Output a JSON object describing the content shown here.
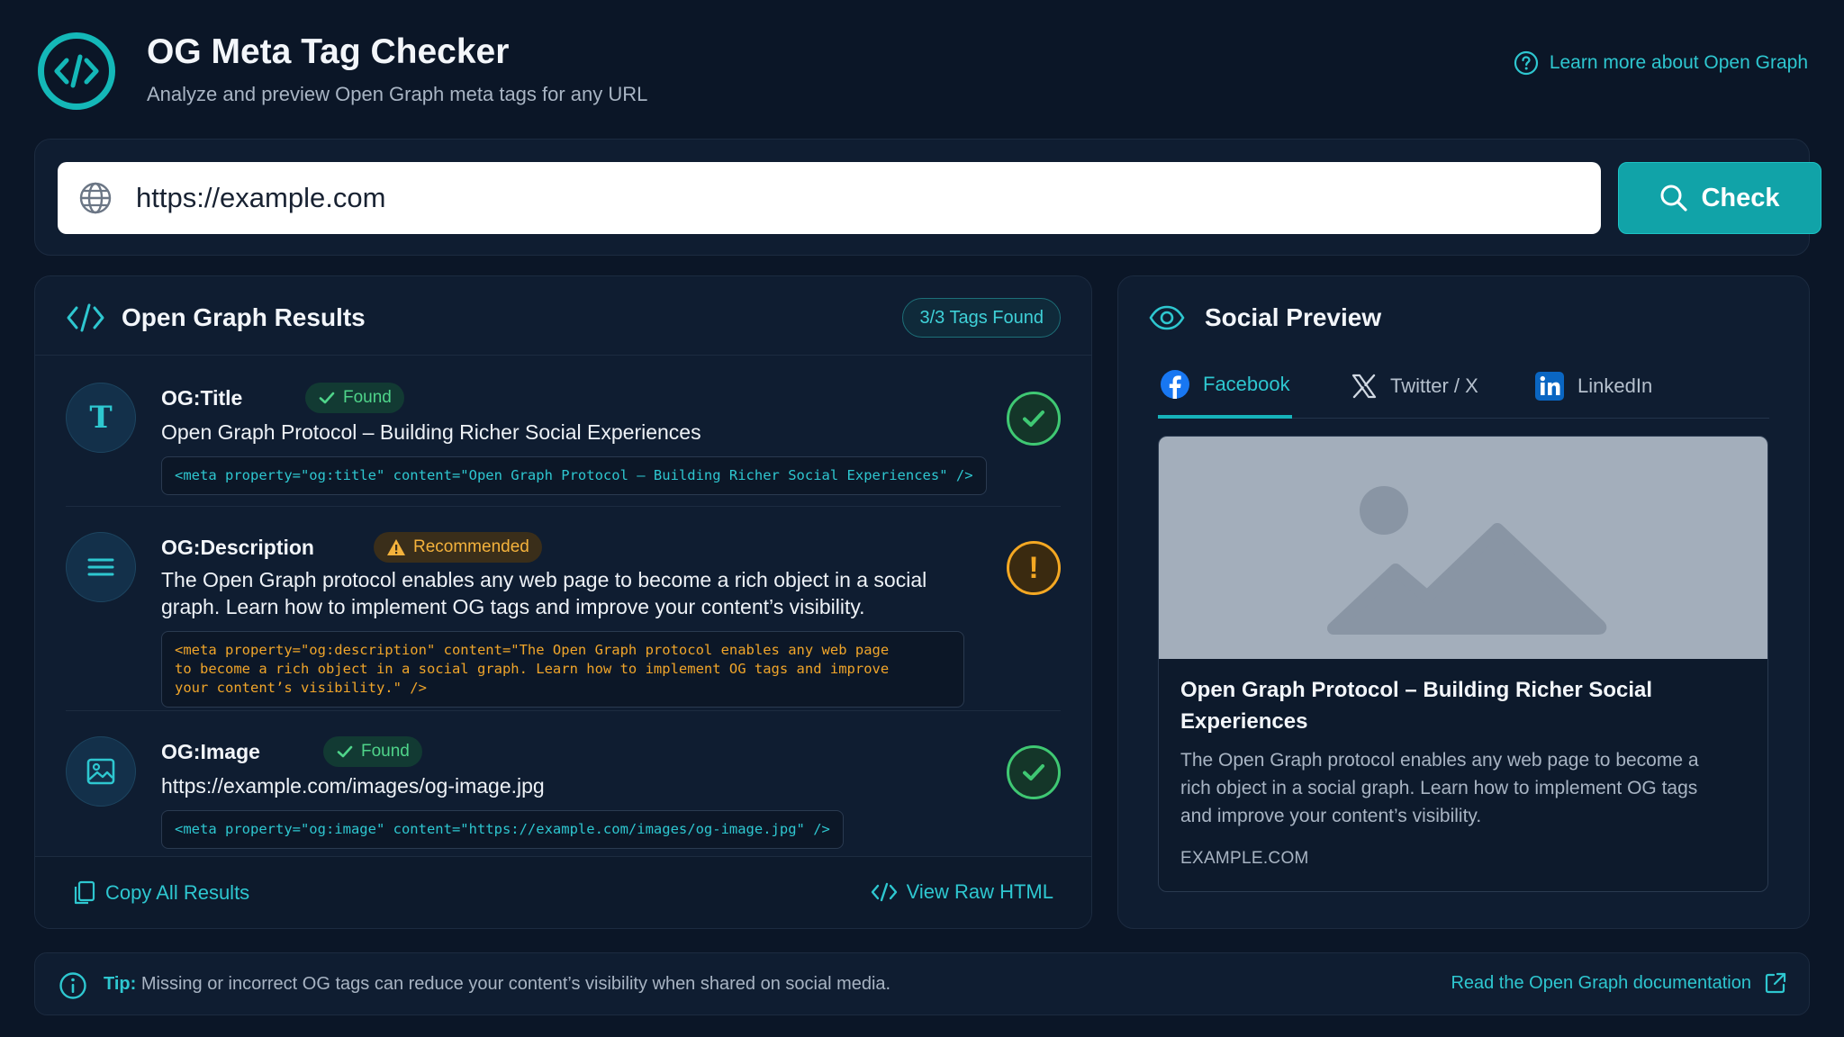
{
  "header": {
    "title": "OG Meta Tag Checker",
    "subtitle": "Analyze and preview Open Graph meta tags for any URL",
    "learn_link": "Learn more about Open Graph"
  },
  "search": {
    "url_value": "https://example.com",
    "check_label": "Check"
  },
  "results": {
    "title": "Open Graph Results",
    "tags_found": "3/3 Tags Found",
    "rows": [
      {
        "name": "OG:Title",
        "status_label": "Found",
        "status": "found",
        "value": "Open Graph Protocol – Building Richer Social Experiences",
        "code": "<meta property=\"og:title\" content=\"Open Graph Protocol – Building Richer Social Experiences\" />"
      },
      {
        "name": "OG:Description",
        "status_label": "Recommended",
        "status": "recommended",
        "value_line1": "The Open Graph protocol enables any web page to become a rich object in a social",
        "value_line2": "graph. Learn how to implement OG tags and improve your content’s visibility.",
        "code": "<meta property=\"og:description\" content=\"The Open Graph protocol enables any web page\nto become a rich object in a social graph. Learn how to implement OG tags and improve\nyour content’s visibility.\" />"
      },
      {
        "name": "OG:Image",
        "status_label": "Found",
        "status": "found",
        "value": "https://example.com/images/og-image.jpg",
        "code": "<meta property=\"og:image\" content=\"https://example.com/images/og-image.jpg\" />"
      }
    ],
    "copy_all": "Copy All Results",
    "view_raw": "View Raw HTML"
  },
  "preview": {
    "title": "Social Preview",
    "tabs": [
      {
        "label": "Facebook",
        "icon": "facebook-icon",
        "active": true
      },
      {
        "label": "Twitter / X",
        "icon": "x-icon",
        "active": false
      },
      {
        "label": "LinkedIn",
        "icon": "linkedin-icon",
        "active": false
      }
    ],
    "card": {
      "title": "Open Graph Protocol – Building Richer Social Experiences",
      "description": "The Open Graph protocol enables any web page to become a rich object in a social graph. Learn how to implement OG tags and improve your content’s visibility.",
      "domain": "EXAMPLE.COM"
    }
  },
  "tip": {
    "label": "Tip:",
    "text": "Missing or incorrect OG tags can reduce your content’s visibility when shared on social media.",
    "doc_link": "Read the Open Graph documentation"
  },
  "colors": {
    "background": "#0b1627",
    "panel": "#0f1d31",
    "accent": "#2ec7d0",
    "button": "#11a3a8",
    "success": "#3fc873",
    "warning": "#f4a823"
  }
}
